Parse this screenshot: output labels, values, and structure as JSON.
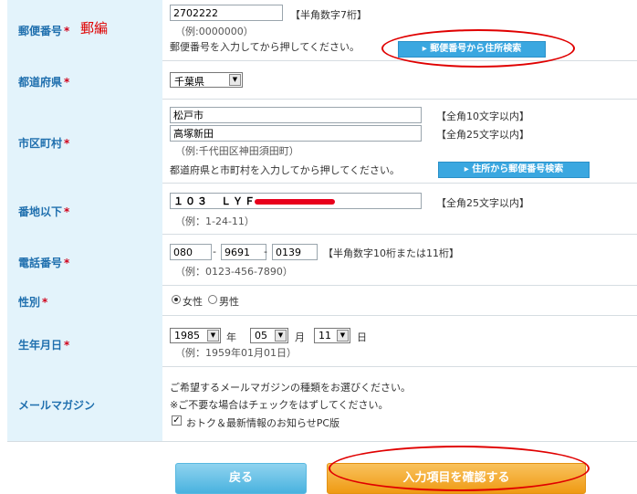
{
  "postal": {
    "label": "郵便番号",
    "annotation": "郵編",
    "value": "2702222",
    "hint": "（例:0000000）",
    "format_note": "【半角数字7桁】",
    "instruction": "郵便番号を入力してから押してください。",
    "search_button": "▸ 郵便番号から住所検索"
  },
  "prefecture": {
    "label": "都道府県",
    "selected": "千葉県"
  },
  "city": {
    "label": "市区町村",
    "value1": "松戸市",
    "note1": "【全角10文字以内】",
    "value2": "高塚新田",
    "note2": "【全角25文字以内】",
    "hint": "（例:千代田区神田須田町）",
    "instruction": "都道府県と市町村を入力してから押してください。",
    "search_button": "▸ 住所から郵便番号検索"
  },
  "street": {
    "label": "番地以下",
    "value": "１０３　ＬＹＦ",
    "note": "【全角25文字以内】",
    "hint": "（例：1-24-11）"
  },
  "phone": {
    "label": "電話番号",
    "p1": "080",
    "p2": "9691",
    "p3": "0139",
    "sep": "-",
    "note": "【半角数字10桁または11桁】",
    "hint": "（例：0123-456-7890）"
  },
  "gender": {
    "label": "性別",
    "options": [
      "女性",
      "男性"
    ],
    "selected": "女性"
  },
  "birthday": {
    "label": "生年月日",
    "year": "1985",
    "year_unit": "年",
    "month": "05",
    "month_unit": "月",
    "day": "11",
    "day_unit": "日",
    "hint": "（例：1959年01月01日）"
  },
  "magazine": {
    "label": "メールマガジン",
    "line1": "ご希望するメールマガジンの種類をお選びください。",
    "line2": "※ご不要な場合はチェックをはずしてください。",
    "checkbox_label": "おトク＆最新情報のお知らせPC版",
    "checked": true
  },
  "required_mark": "*",
  "buttons": {
    "back": "戻る",
    "confirm": "入力項目を確認する"
  },
  "colors": {
    "label_bg": "#e3f3fb",
    "label_text": "#1f6fae",
    "required": "#d0021b",
    "annotation": "#e00000"
  }
}
